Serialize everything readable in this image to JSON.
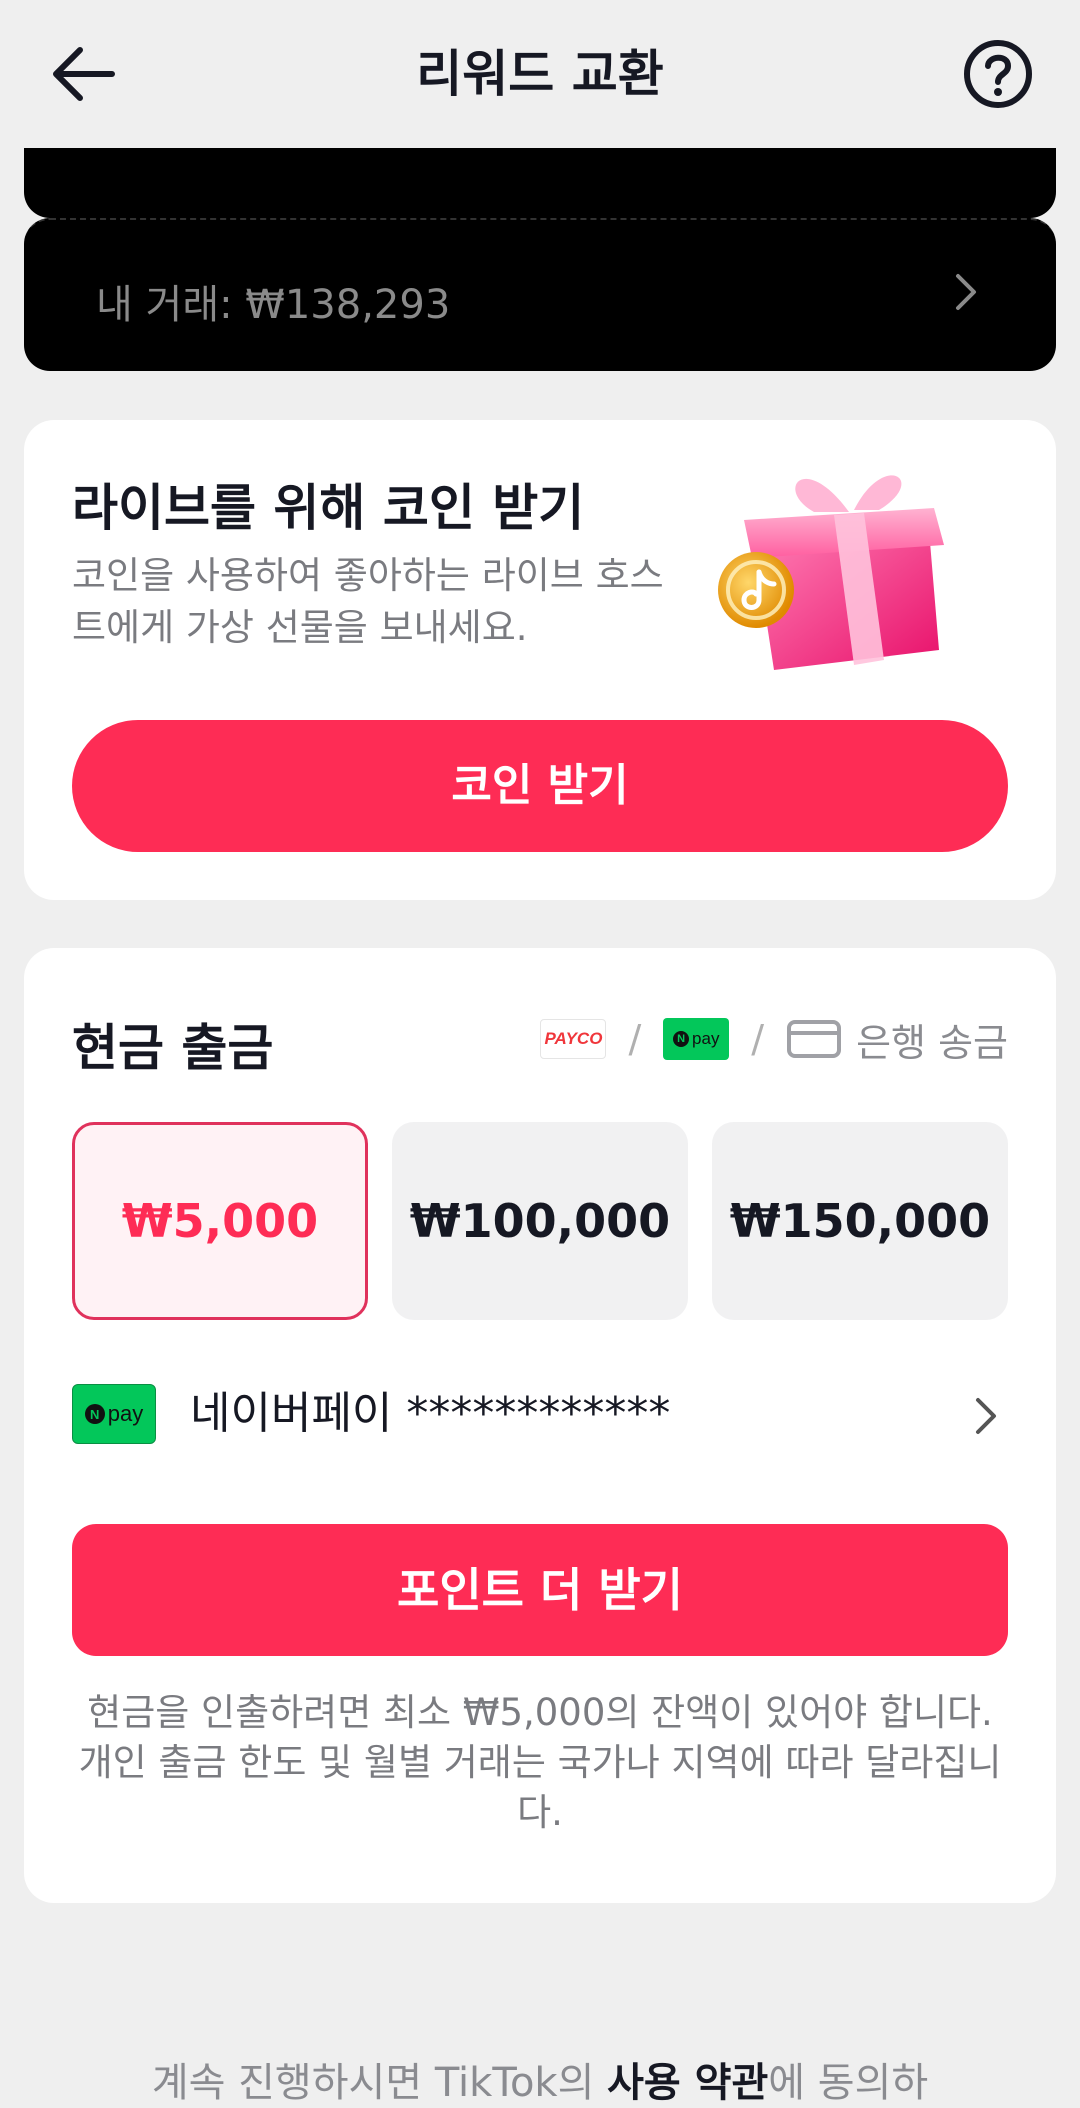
{
  "header": {
    "title": "리워드 교환"
  },
  "balance_card": {
    "transactions_label": "내 거래: ₩138,293"
  },
  "coins_card": {
    "title": "라이브를 위해 코인 받기",
    "description": "코인을 사용하여 좋아하는 라이브 호스트에게 가상 선물을 보내세요.",
    "button_label": "코인 받기"
  },
  "cash_card": {
    "title": "현금 출금",
    "methods": {
      "payco": "PAYCO",
      "npay": "pay",
      "npay_n": "N",
      "bank": "은행 송금"
    },
    "amounts": [
      "₩5,000",
      "₩100,000",
      "₩150,000"
    ],
    "account": {
      "label": "네이버페이 ************",
      "logo_text": "pay",
      "logo_n": "N"
    },
    "more_button": "포인트 더 받기",
    "note": "현금을 인출하려면 최소 ₩5,000의 잔액이 있어야 합니다. 개인 출금 한도 및 월별 거래는 국가나 지역에 따라 달라집니다."
  },
  "footer": {
    "prefix": "계속 진행하시면 TikTok의 ",
    "terms_link": "사용 약관",
    "suffix": "에 동의하"
  },
  "colors": {
    "accent": "#fe2c55",
    "npay": "#03c75a",
    "background": "#efefef"
  }
}
